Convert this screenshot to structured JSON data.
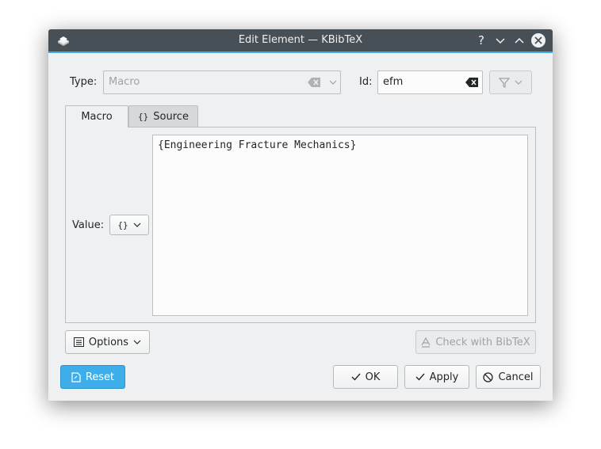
{
  "window": {
    "title": "Edit Element — KBibTeX",
    "controls": {
      "help": "?",
      "minimize": "⌄",
      "maximize": "⌃",
      "close": "✕"
    }
  },
  "type_field": {
    "label": "Type:",
    "value": "Macro"
  },
  "id_field": {
    "label": "Id:",
    "value": "efm"
  },
  "tabs": [
    {
      "label": "Macro",
      "active": true
    },
    {
      "label": "Source",
      "icon": "braces-icon",
      "active": false
    }
  ],
  "macro_tab": {
    "value_label": "Value:",
    "type_selector": "{}",
    "value_text": "{Engineering Fracture Mechanics}"
  },
  "buttons": {
    "options": "Options",
    "check_bibtex": "Check with BibTeX",
    "reset": "Reset",
    "ok": "OK",
    "apply": "Apply",
    "cancel": "Cancel"
  },
  "colors": {
    "titlebar": "#475057",
    "accent": "#3daee9",
    "window_bg": "#eff0f1"
  }
}
